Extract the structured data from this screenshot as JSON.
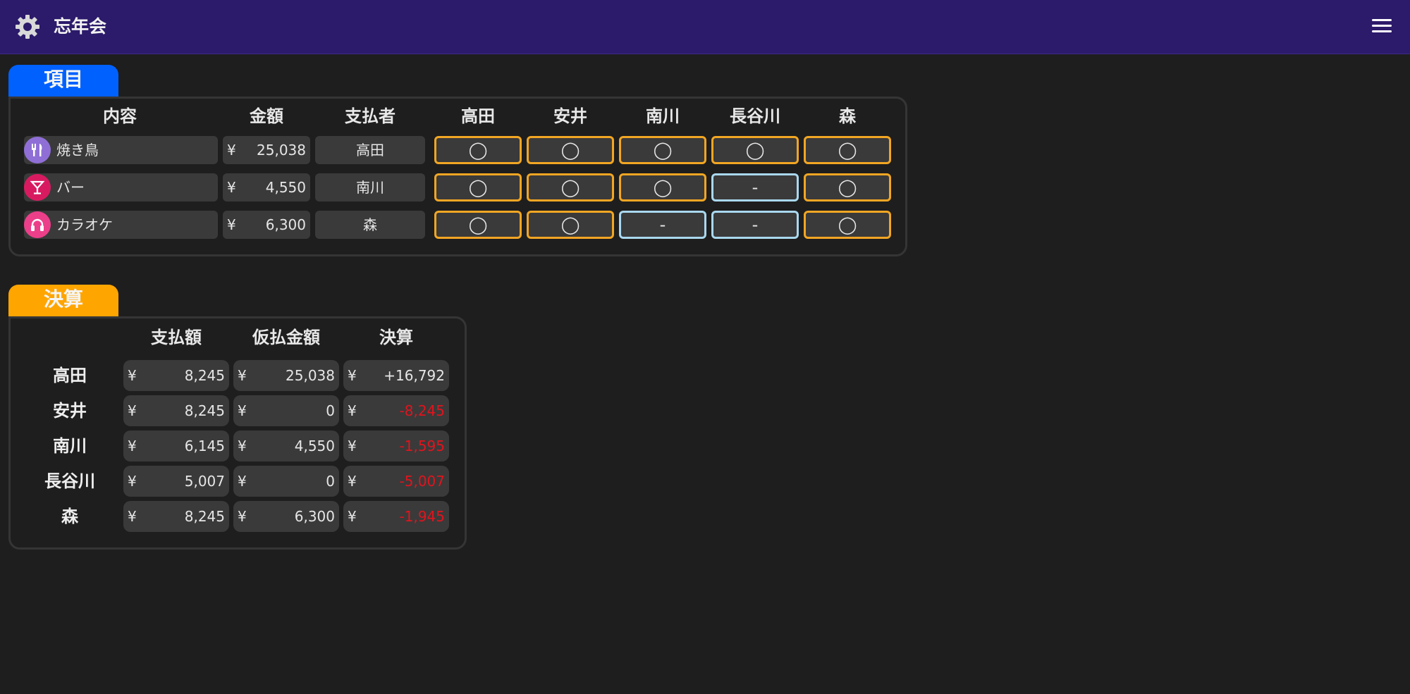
{
  "header": {
    "title": "忘年会",
    "icon": "gear-icon",
    "menu_icon": "hamburger-menu-icon",
    "background": "#2c1a6b"
  },
  "items": {
    "tab_label": "項目",
    "tab_color": "#0061fe",
    "columns": {
      "content": "内容",
      "amount": "金額",
      "payer": "支払者",
      "members": [
        "高田",
        "安井",
        "南川",
        "長谷川",
        "森"
      ]
    },
    "currency": "¥",
    "rows": [
      {
        "icon": "utensils-icon",
        "icon_color": "#8f6fd6",
        "name": "焼き鳥",
        "amount": "25,038",
        "payer": "高田",
        "participation": [
          "◯",
          "◯",
          "◯",
          "◯",
          "◯"
        ]
      },
      {
        "icon": "cocktail-icon",
        "icon_color": "#d81b60",
        "name": "バー",
        "amount": "4,550",
        "payer": "南川",
        "participation": [
          "◯",
          "◯",
          "◯",
          "-",
          "◯"
        ]
      },
      {
        "icon": "headphones-icon",
        "icon_color": "#ec3f8a",
        "name": "カラオケ",
        "amount": "6,300",
        "payer": "森",
        "participation": [
          "◯",
          "◯",
          "-",
          "-",
          "◯"
        ]
      }
    ]
  },
  "settlement": {
    "tab_label": "決算",
    "tab_color": "#ffa500",
    "columns": {
      "paid": "支払額",
      "advance": "仮払金額",
      "balance": "決算"
    },
    "currency": "¥",
    "rows": [
      {
        "name": "高田",
        "paid": "8,245",
        "advance": "25,038",
        "balance": "+16,792"
      },
      {
        "name": "安井",
        "paid": "8,245",
        "advance": "0",
        "balance": "-8,245"
      },
      {
        "name": "南川",
        "paid": "6,145",
        "advance": "4,550",
        "balance": "-1,595"
      },
      {
        "name": "長谷川",
        "paid": "5,007",
        "advance": "0",
        "balance": "-5,007"
      },
      {
        "name": "森",
        "paid": "8,245",
        "advance": "6,300",
        "balance": "-1,945"
      }
    ]
  }
}
